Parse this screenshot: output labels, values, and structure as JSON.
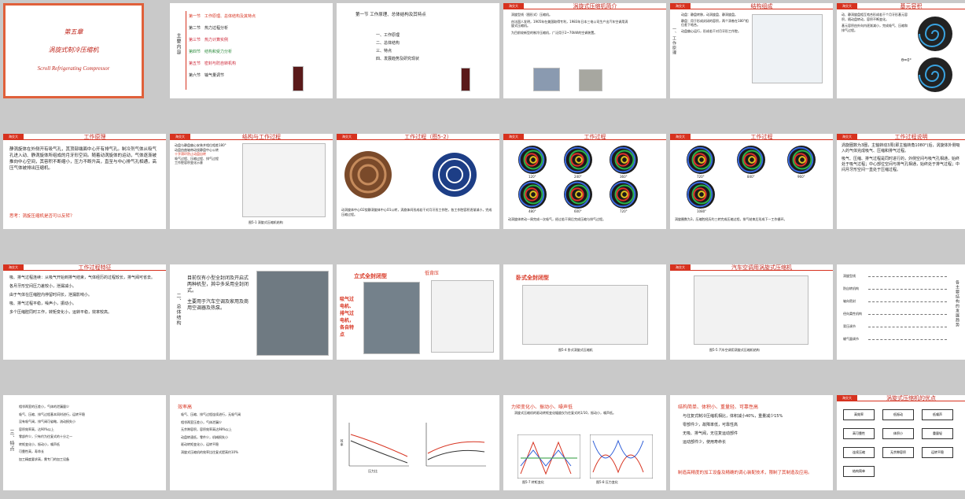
{
  "badge": "海交大",
  "s1": {
    "chapter": "第五章",
    "title_cn": "涡旋式制冷压缩机",
    "title_en": "Scroll Refrigerating Compressor"
  },
  "s2": {
    "side": "主要内容",
    "items": [
      "第一节　工作原理、总体结构及其特点",
      "第二节　热力过程分析",
      "第三节　热力计算实例",
      "第四节　结构和受力分析",
      "第五节　密封与防自转机构",
      "第六节　输气量调节"
    ]
  },
  "s3": {
    "head": "第一节 工作原理、总体结构及其特点",
    "items": [
      "一、工作原理",
      "二、总体结构",
      "三、特点",
      "四、发展趋势及研究现状"
    ]
  },
  "s4": {
    "title": "涡旋式压缩机简介",
    "b1": "涡旋型线（图形式）压缩机。",
    "b2": "由法国人发明，1905年在美国取得专利，1983年日本三电公司生产出汽车空调用涡旋式压缩机。",
    "b3": "为目前较新型的制冷压缩机，广泛用于2~70kW的空调装置。"
  },
  "s5": {
    "title": "结构组成",
    "side": "一、工作原理",
    "b1": "动盘：静盘转移，动涡旋盘、静涡旋盘。",
    "b2": "静盘：用于形成封闭的容积，两个涡卷在180°相位差下啮合。",
    "b3": "动盘偏心运行，形成若干对月牙形工作腔。"
  },
  "s6": {
    "title": "基元容积",
    "b1": "动、静涡旋盘相互啮合形成若干个月牙形基元容积，随动盘转动，容积不断变化。",
    "b2": "基元容积由外向内逐渐减小，完成吸气、压缩和排气过程。",
    "label": "θ=0°"
  },
  "s7": {
    "title": "工作原理",
    "p1": "静涡旋体在外侧开有吸气孔，其顶部端面中心开有排气孔。制冷剂气体从吸气孔进入动、静涡旋体所组成的月牙形空间。随着动涡旋体的运动，气体逐渐被推向中心空间，其容积不断缩小，压力不断升高，直至与中心排气孔相通，高压气体被排出压缩机。",
    "q": "思考：涡旋压缩机是否可以反转？"
  },
  "s8": {
    "title": "结构与工作过程",
    "notes": [
      "动盘与静盘偏心安装并相位相差180°",
      "动盘由曲轴带动绕静盘中心公转",
      "十字滑环防止动盘自转",
      "吸气过程、压缩过程、排气过程",
      "工作腔容积变化示意"
    ],
    "caption": "图5-1 涡旋式压缩机结构"
  },
  "s9": {
    "title": "工作过程（图5-2）",
    "caption": "动涡旋体中心O2绕静涡旋体中心O1公转，涡旋体间形成若干对月牙形工作腔，各工作腔容积逐渐减小，完成压缩过程。"
  },
  "s10": {
    "title": "工作过程",
    "angles": [
      "120°",
      "240°",
      "360°",
      "480°",
      "600°",
      "720°"
    ],
    "caption": "动涡旋体转动一周完成一次吸气，经过若干周后完成压缩与排气过程。"
  },
  "s11": {
    "title": "工作过程",
    "angles": [
      "720°",
      "840°",
      "960°",
      "1080°"
    ],
    "caption": "涡旋圈数为3，压缩腔经历约三转完成压缩过程，排气结束后形成下一工作循环。"
  },
  "s12": {
    "title": "工作过程说明",
    "p1": "涡旋圈数为3圈，主轴转动3周(即主轴转角1080°)后，涡旋体外侧吸入的气体完成吸气、压缩和排气过程。",
    "p2": "吸气、压缩、排气过程是同时进行的，外侧空间与吸气孔相通，始终处于吸气过程；中心部位空间与排气孔相通，始终处于排气过程；中间月牙形空间一直处于压缩过程。"
  },
  "s13": {
    "title": "工作过程特征",
    "items": [
      "吸、排气过程连续：从吸气开始到排气结束，气体经历的过程较长，排气阀可省去。",
      "各月牙形空间压力差较小，泄漏减小。",
      "由于气体在压缩腔内停留时间长，泄漏影响小。",
      "吸、排气过程平稳，噪声小，振动小。",
      "多个压缩腔同时工作，转矩变化小，运转平稳，效率较高。"
    ]
  },
  "s14": {
    "side": "二、总体结构",
    "b1": "目前仅有小型全封闭及开启式两种机型，其中多采用全封闭式。",
    "b2": "主要用于汽车空调及家用及商用空调器及热泵。"
  },
  "s15": {
    "label_top": "立式全封闭型",
    "label_right": "低背压",
    "side_label": "吸气过电机、排气过电机，各自特点"
  },
  "s16": {
    "label": "卧式全封闭型",
    "caption": "图5-4 卧式涡旋式压缩机"
  },
  "s17": {
    "title": "汽车空调用涡旋式压缩机",
    "caption": "图5-5 汽车空调用涡旋式压缩机结构"
  },
  "s18": {
    "side": "各主要结构的发展趋势",
    "rows": [
      "涡旋型线",
      "防自转机构",
      "轴向密封",
      "径向柔性机构",
      "背压调节",
      "输气量调节"
    ]
  },
  "s19": {
    "side": "三、特点",
    "items": [
      "相邻两室的压差小，气体的泄漏量少",
      "吸气、压缩、排气过程基本同时进行，运转平稳",
      "没有吸气阀，排气阀可省略，流动损失小",
      "容积效率高，达90%以上",
      "零部件少，只有约为往复式的十分之一",
      "转矩变化小，振动小，噪声低",
      "可靠性高，寿命长",
      "加工精度要求高，需专门的加工设备"
    ]
  },
  "s20": {
    "head": "效率高",
    "items": [
      "吸气、压缩、排气过程连续进行，无吸气阀",
      "相邻两室压差小，气体泄漏少",
      "无余隙容积，容积效率高达98%以上",
      "动盘转速低，零件少，机械损失小",
      "驱动转矩变化小，运转平稳",
      "涡旋式压缩机的效率比往复式提高约10%"
    ],
    "ylabel": "效率",
    "xlabel": "压力比"
  },
  "s21": {
    "head": "力矩变化小、振动小、噪声低",
    "sub": "涡旋式压缩机的驱动转矩变化幅度仅为往复式的1/10，振动小，噪声低。",
    "cap1": "图5-7 转矩变化",
    "cap2": "图5-8 压力变化"
  },
  "s22": {
    "head": "结构简单、体积小、重量轻、可靠性高",
    "items": [
      "与往复式制冷压缩机相比，体积减小40%，重量减少15%",
      "零部件少，故障率低，可靠性高",
      "无吸、排气阀，无往复运动部件",
      "运动部件少，使用寿命长"
    ],
    "foot": "制造高精度的加工设备及精确的调心装配技术，限制了其制造及应用。"
  },
  "s23": {
    "title": "涡旋式压缩机的优点",
    "boxes": [
      "高效率",
      "低振动",
      "低噪声",
      "高可靠性",
      "体积小",
      "重量轻",
      "连续压缩",
      "无余隙容积",
      "运转平稳",
      "结构简单"
    ]
  }
}
